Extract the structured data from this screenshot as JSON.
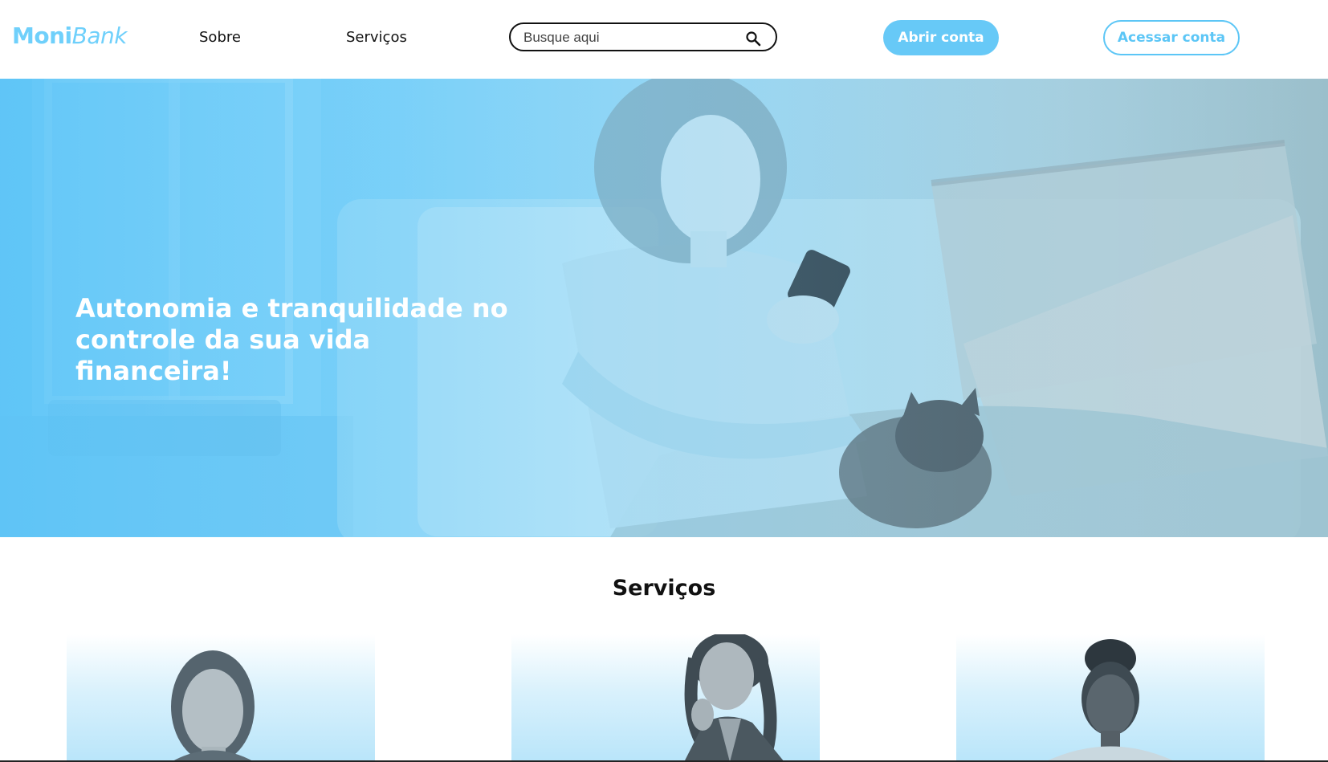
{
  "brand": {
    "name_bold": "Moni",
    "name_italic": "Bank",
    "accent": "#67c9f7"
  },
  "nav": {
    "items": [
      {
        "label": "Sobre"
      },
      {
        "label": "Serviços"
      }
    ]
  },
  "search": {
    "placeholder": "Busque aqui",
    "icon": "search-icon"
  },
  "actions": {
    "open_account": "Abrir conta",
    "access_account": "Acessar conta"
  },
  "hero": {
    "headline": "Autonomia e tranquilidade no controle da sua vida financeira!"
  },
  "services": {
    "title": "Serviços"
  }
}
